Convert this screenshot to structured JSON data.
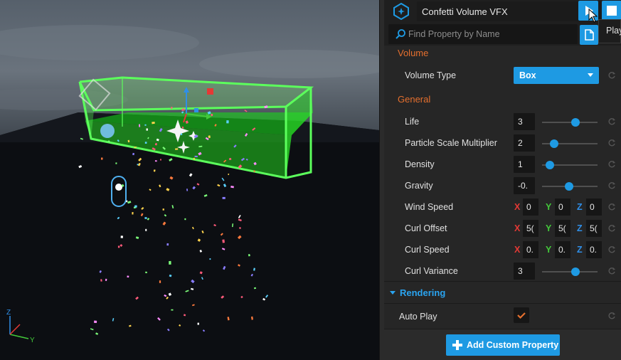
{
  "header": {
    "object_name": "Confetti Volume VFX",
    "search_placeholder": "Find Property by Name",
    "tooltip": "Play"
  },
  "sections": {
    "volume": "Volume",
    "general": "General",
    "rendering": "Rendering"
  },
  "volume": {
    "type_label": "Volume Type",
    "type_value": "Box"
  },
  "general": {
    "life": {
      "label": "Life",
      "value": "3",
      "slider": 0.6
    },
    "particle_scale": {
      "label": "Particle Scale Multiplier",
      "value": "2",
      "slider": 0.22
    },
    "density": {
      "label": "Density",
      "value": "1",
      "slider": 0.14
    },
    "gravity": {
      "label": "Gravity",
      "value": "-0.",
      "slider": 0.49
    },
    "wind_speed": {
      "label": "Wind Speed",
      "x": "0",
      "y": "0",
      "z": "0"
    },
    "curl_offset": {
      "label": "Curl Offset",
      "x": "5(",
      "y": "5(",
      "z": "5("
    },
    "curl_speed": {
      "label": "Curl Speed",
      "x": "0.",
      "y": "0.",
      "z": "0."
    },
    "curl_variance": {
      "label": "Curl Variance",
      "value": "3",
      "slider": 0.6
    }
  },
  "rendering": {
    "auto_play_label": "Auto Play",
    "auto_play_checked": true
  },
  "axis_labels": {
    "x": "X",
    "y": "Y",
    "z": "Z"
  },
  "footer": {
    "add_custom_property": "Add Custom Property"
  },
  "colors": {
    "accent": "#1e9ae3",
    "section": "#e46f2e",
    "axis_x": "#e53935",
    "axis_y": "#43c93a",
    "axis_z": "#2f8fe8",
    "volume_green": "#38ff38"
  },
  "icons": {
    "vfx": "vfx-hex-icon",
    "play": "play-icon",
    "stop": "stop-icon",
    "search": "search-icon",
    "doc": "document-icon",
    "reset": "reset-arrow-icon",
    "add": "plus-icon"
  }
}
